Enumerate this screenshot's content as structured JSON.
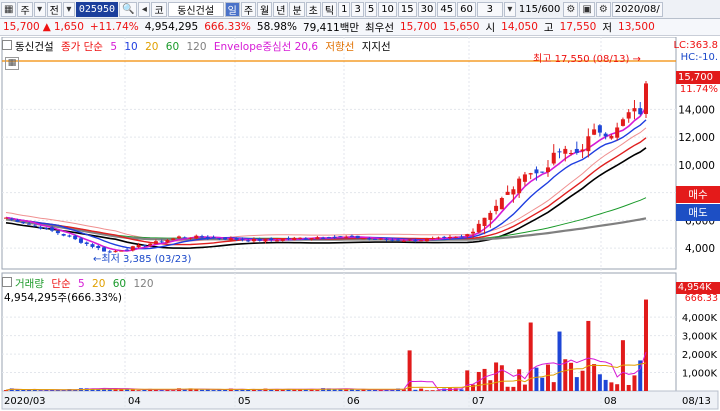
{
  "toolbar": {
    "market": "주",
    "period_selector": "전",
    "code": "025950",
    "type": "코",
    "name": "동신건설",
    "tabs": [
      "일",
      "주",
      "월",
      "년",
      "분",
      "초",
      "틱"
    ],
    "active_tab": "일",
    "intervals": [
      "1",
      "3",
      "5",
      "10",
      "15",
      "30",
      "45",
      "60"
    ],
    "interval_value": "3",
    "count": "115/600",
    "date": "2020/08/"
  },
  "quote": {
    "price": "15,700",
    "change": "1,650",
    "change_pct": "+11.74%",
    "volume": "4,954,295",
    "volume_ratio": "666.33%",
    "turnover_ratio": "58.98%",
    "amount": "79,411백만",
    "best_ask_label": "최우선",
    "best_ask": "15,700",
    "best_bid": "15,650",
    "open_label": "시",
    "open": "14,050",
    "high_label": "고",
    "high": "17,550",
    "low_label": "저",
    "low": "13,500"
  },
  "price_legend": {
    "name": "동신건설",
    "ma_label": "종가 단순",
    "ma_periods": [
      "5",
      "10",
      "20",
      "60",
      "120"
    ],
    "envelope": "Envelope중심선 20,6",
    "resistance": "저항선",
    "support": "지지선"
  },
  "volume_legend": {
    "name": "거래량",
    "ma_label": "단순",
    "ma_periods": [
      "5",
      "20",
      "60",
      "120"
    ],
    "value": "4,954,295주(666.33%)"
  },
  "annotations": {
    "high": "최고 17,550 (08/13)",
    "low": "최저 3,385 (03/23)"
  },
  "right_panel": {
    "lc": "LC:363.8",
    "hc": "HC:-10.",
    "price_tag": "15,700",
    "pct_tag": "11.74%",
    "buy": "매수",
    "sell": "매도",
    "vol_tag": "4,954K",
    "vol_pct_tag": "666.33"
  },
  "colors": {
    "up": "#e11b1b",
    "down": "#1e46d6",
    "ma5": "#d61ad6",
    "ma10": "#1f3ee0",
    "ma20": "#e02020",
    "ma60": "#1a9a2a",
    "ma120": "#808080",
    "envelope": "#f09090",
    "resistance": "#f28a00"
  },
  "chart_data": {
    "type": "candlestick",
    "price_axis": [
      4000,
      6000,
      8000,
      10000,
      12000,
      14000
    ],
    "price_axis_labels": [
      "4,000",
      "6,000",
      "8,000",
      "10,000",
      "12,000",
      "14,000"
    ],
    "volume_axis_labels": [
      "1,000K",
      "2,000K",
      "3,000K",
      "4,000K"
    ],
    "volume_axis": [
      1000,
      2000,
      3000,
      4000
    ],
    "x_axis_labels": [
      "2020/03",
      "04",
      "05",
      "06",
      "07",
      "08",
      "08/13"
    ],
    "price_range": [
      2500,
      18200
    ],
    "volume_range": [
      0,
      5200
    ],
    "last_close": 15700,
    "period_high": 17550,
    "period_low": 3385
  }
}
